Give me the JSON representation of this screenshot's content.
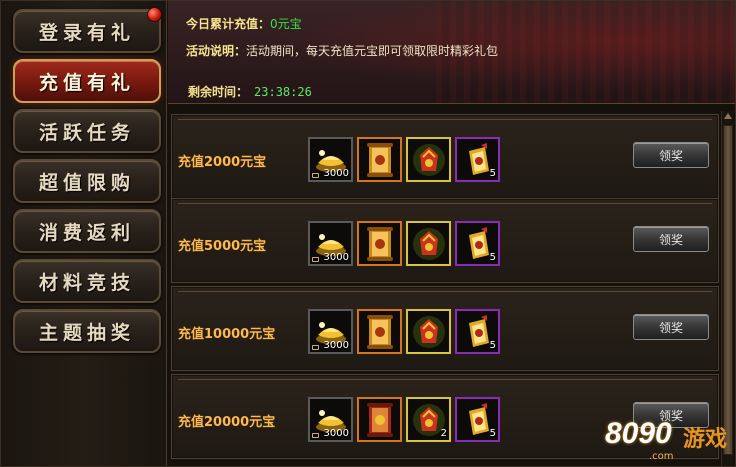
{
  "sidebar": {
    "items": [
      {
        "label": "登录有礼",
        "active": false
      },
      {
        "label": "充值有礼",
        "active": true
      },
      {
        "label": "活跃任务",
        "active": false
      },
      {
        "label": "超值限购",
        "active": false
      },
      {
        "label": "消费返利",
        "active": false
      },
      {
        "label": "材料竞技",
        "active": false
      },
      {
        "label": "主题抽奖",
        "active": false
      }
    ]
  },
  "header": {
    "today_label": "今日累计充值：",
    "today_value": "0元宝",
    "desc_label": "活动说明：",
    "desc_text": "活动期间，每天充值元宝即可领取限时精彩礼包",
    "timer_label": "剩余时间：",
    "timer_value": "23:38:26"
  },
  "tiers": [
    {
      "label": "充值2000元宝",
      "claim": "领奖",
      "items": [
        {
          "icon": "gold-ingot-icon",
          "count": "3000",
          "border": "gray"
        },
        {
          "icon": "scroll-icon",
          "count": "",
          "border": "orange"
        },
        {
          "icon": "red-bag-icon",
          "count": "",
          "border": "gold"
        },
        {
          "icon": "token-icon",
          "count": "5",
          "border": "purple"
        }
      ]
    },
    {
      "label": "充值5000元宝",
      "claim": "领奖",
      "items": [
        {
          "icon": "gold-ingot-icon",
          "count": "3000",
          "border": "gray"
        },
        {
          "icon": "scroll-icon",
          "count": "",
          "border": "orange"
        },
        {
          "icon": "red-bag-icon",
          "count": "",
          "border": "gold"
        },
        {
          "icon": "token-icon",
          "count": "5",
          "border": "purple"
        }
      ]
    },
    {
      "label": "充值10000元宝",
      "claim": "领奖",
      "items": [
        {
          "icon": "gold-ingot-icon",
          "count": "3000",
          "border": "gray"
        },
        {
          "icon": "scroll-icon",
          "count": "",
          "border": "orange"
        },
        {
          "icon": "red-bag-icon",
          "count": "",
          "border": "gold"
        },
        {
          "icon": "token-icon",
          "count": "5",
          "border": "purple"
        }
      ]
    },
    {
      "label": "充值20000元宝",
      "claim": "领奖",
      "items": [
        {
          "icon": "gold-ingot-icon",
          "count": "3000",
          "border": "gray"
        },
        {
          "icon": "red-scroll-icon",
          "count": "",
          "border": "orange"
        },
        {
          "icon": "red-bag-icon",
          "count": "2",
          "border": "gold"
        },
        {
          "icon": "token-icon",
          "count": "5",
          "border": "purple"
        }
      ]
    }
  ],
  "watermark": {
    "num": "8090",
    "cn": "游戏",
    "dom": ".com"
  }
}
